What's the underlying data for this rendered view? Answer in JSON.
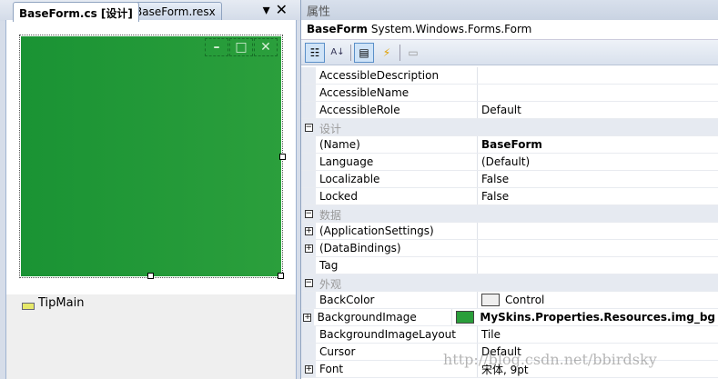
{
  "tabs": [
    {
      "label": "BaseForm.cs [设计]",
      "active": true
    },
    {
      "label": "BaseForm.resx",
      "active": false
    }
  ],
  "tab_icons": {
    "dropdown": "▾",
    "close": "✕"
  },
  "form_caption": {
    "minimize": "–",
    "maximize": "□",
    "close": "✕"
  },
  "form_bg": "#1e9736",
  "tray": {
    "component": "TipMain"
  },
  "properties": {
    "title": "属性",
    "object_name": "BaseForm",
    "object_type": "System.Windows.Forms.Form",
    "rows": [
      {
        "name": "AccessibleDescription",
        "value": ""
      },
      {
        "name": "AccessibleName",
        "value": ""
      },
      {
        "name": "AccessibleRole",
        "value": "Default"
      },
      {
        "category": "设计"
      },
      {
        "name": "(Name)",
        "value": "BaseForm",
        "bold": true
      },
      {
        "name": "Language",
        "value": "(Default)"
      },
      {
        "name": "Localizable",
        "value": "False"
      },
      {
        "name": "Locked",
        "value": "False"
      },
      {
        "category": "数据"
      },
      {
        "name": "(ApplicationSettings)",
        "value": "",
        "expand": true
      },
      {
        "name": "(DataBindings)",
        "value": "",
        "expand": true
      },
      {
        "name": "Tag",
        "value": ""
      },
      {
        "category": "外观"
      },
      {
        "name": "BackColor",
        "value": "Control",
        "swatch": "#efefef"
      },
      {
        "name": "BackgroundImage",
        "value": "MySkins.Properties.Resources.img_bg",
        "bold": true,
        "swatch": "#2a9e3a",
        "expand": true
      },
      {
        "name": "BackgroundImageLayout",
        "value": "Tile"
      },
      {
        "name": "Cursor",
        "value": "Default"
      },
      {
        "name": "Font",
        "value": "宋体, 9pt",
        "expand": true
      }
    ]
  },
  "watermark": "http://blog.csdn.net/bbirdsky"
}
